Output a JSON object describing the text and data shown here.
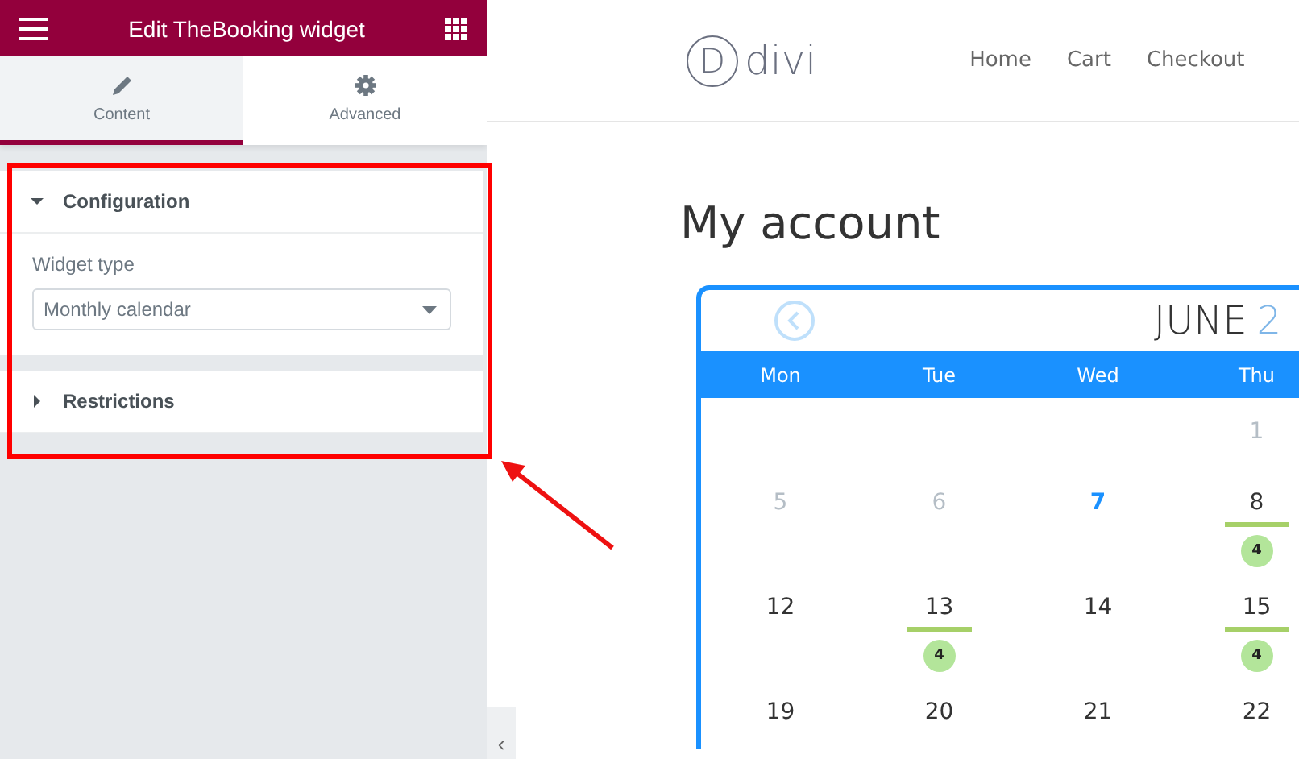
{
  "editor": {
    "title": "Edit TheBooking widget",
    "tabs": [
      {
        "label": "Content",
        "selected": true
      },
      {
        "label": "Advanced",
        "selected": false
      }
    ],
    "sections": [
      {
        "title": "Configuration",
        "expanded": true,
        "fields": [
          {
            "label": "Widget type",
            "value": "Monthly calendar"
          }
        ]
      },
      {
        "title": "Restrictions",
        "expanded": false
      }
    ],
    "collapse_glyph": "‹"
  },
  "site": {
    "logo_letter": "D",
    "logo_text": "divi",
    "nav": [
      "Home",
      "Cart",
      "Checkout"
    ],
    "page_title": "My account"
  },
  "calendar": {
    "month": "JUNE",
    "year": "2",
    "weekdays": [
      "Mon",
      "Tue",
      "Wed",
      "Thu"
    ],
    "weeks": [
      [
        {
          "kind": "empty"
        },
        {
          "kind": "empty"
        },
        {
          "kind": "empty"
        },
        {
          "day": "1",
          "kind": "muted"
        }
      ],
      [
        {
          "day": "5",
          "kind": "muted"
        },
        {
          "day": "6",
          "kind": "muted"
        },
        {
          "day": "7",
          "kind": "today"
        },
        {
          "day": "8",
          "kind": "normal",
          "bookings": "4"
        }
      ],
      [
        {
          "day": "12",
          "kind": "normal"
        },
        {
          "day": "13",
          "kind": "normal",
          "bookings": "4"
        },
        {
          "day": "14",
          "kind": "normal"
        },
        {
          "day": "15",
          "kind": "normal",
          "bookings": "4"
        }
      ],
      [
        {
          "day": "19",
          "kind": "normal"
        },
        {
          "day": "20",
          "kind": "normal"
        },
        {
          "day": "21",
          "kind": "normal"
        },
        {
          "day": "22",
          "kind": "normal"
        }
      ]
    ]
  }
}
